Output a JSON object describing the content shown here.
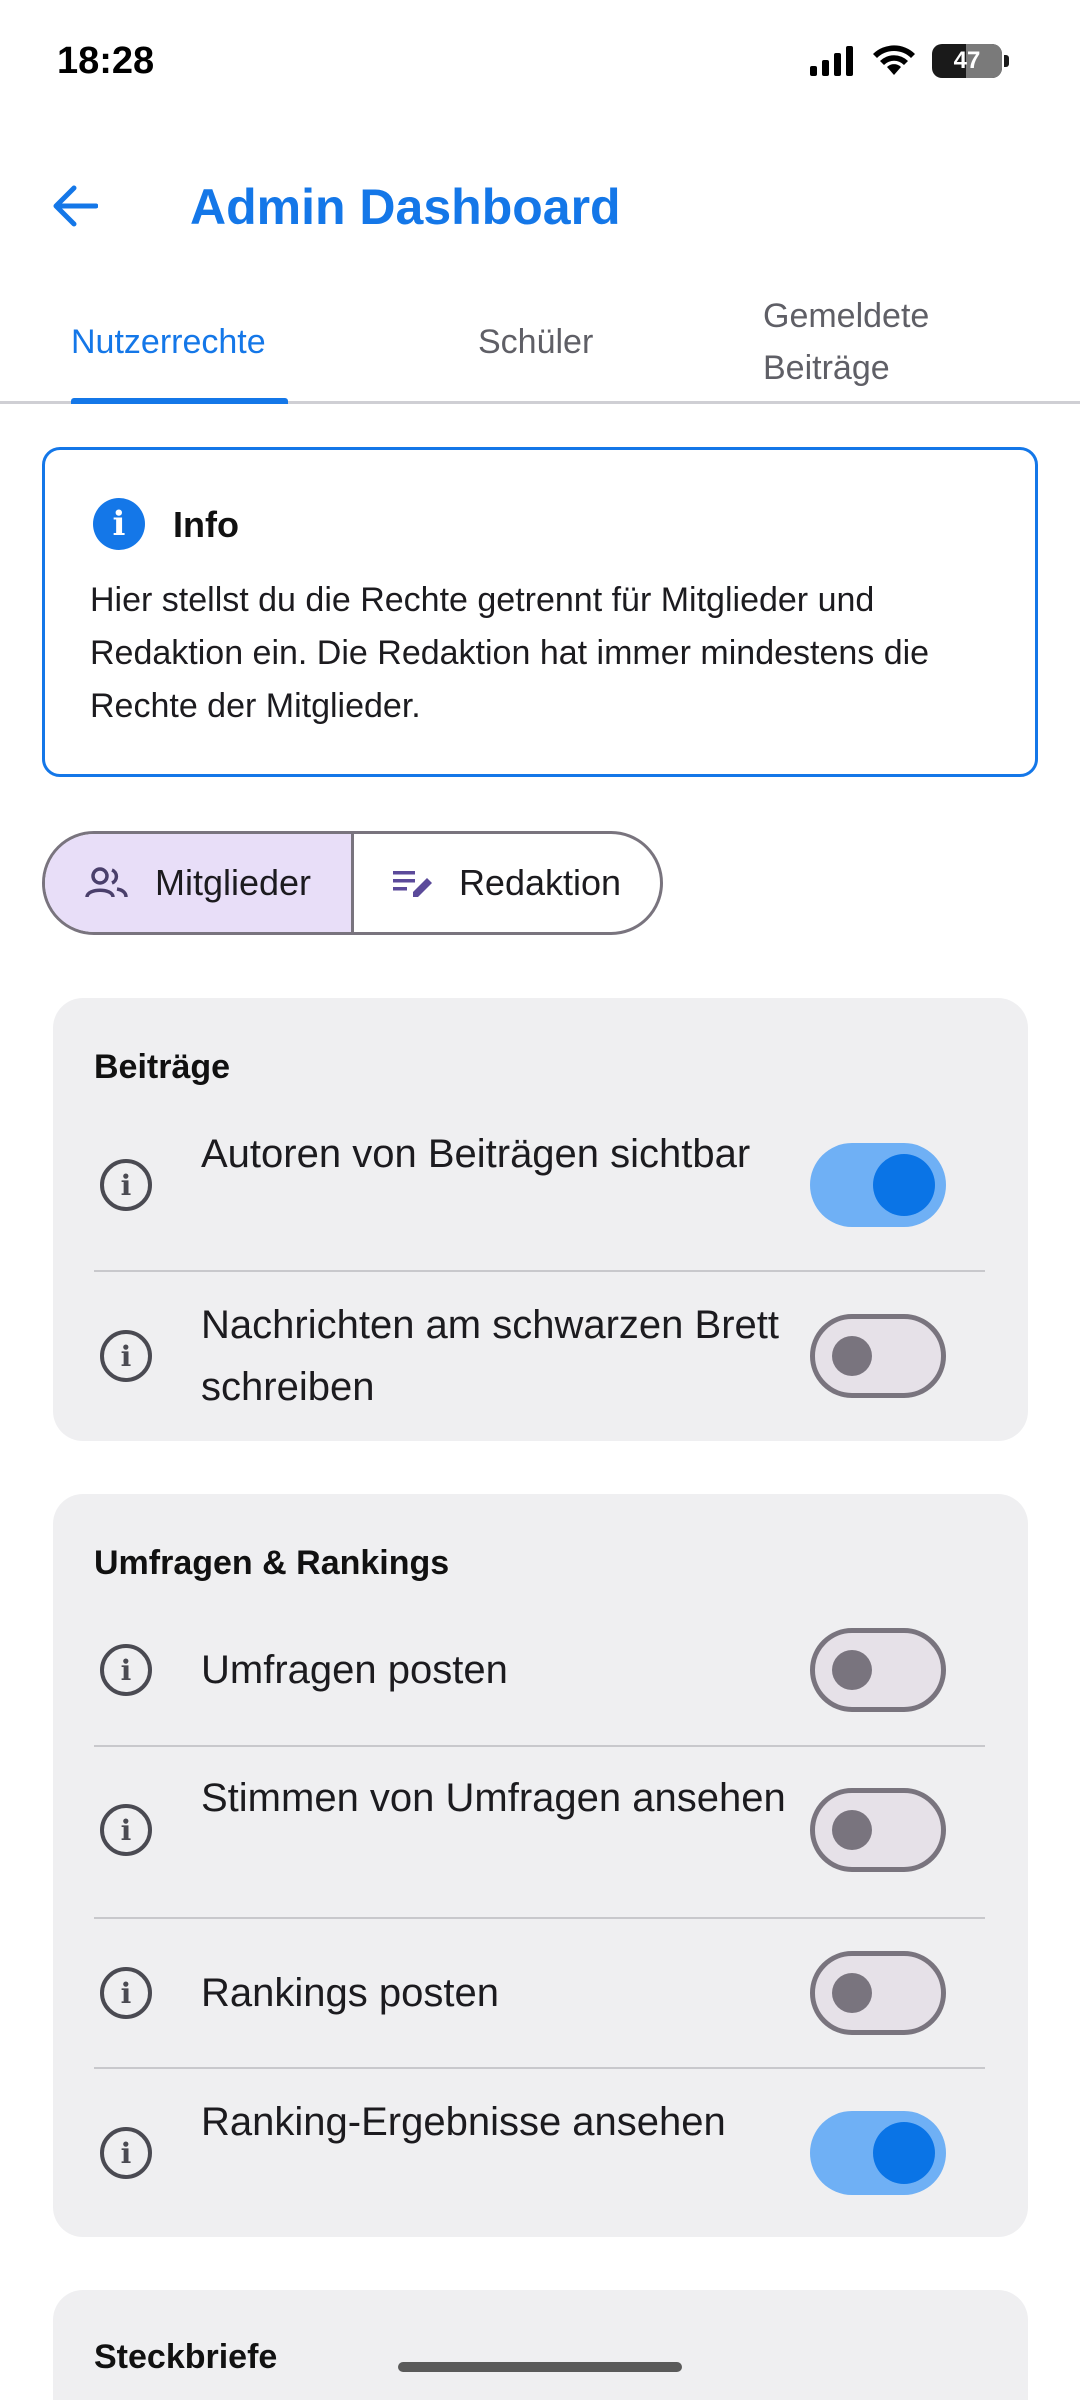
{
  "status": {
    "time": "18:28",
    "battery": "47"
  },
  "header": {
    "title": "Admin Dashboard"
  },
  "tabs": [
    {
      "label": "Nutzerrechte",
      "active": true
    },
    {
      "label": "Schüler",
      "active": false
    },
    {
      "label": "Gemeldete Beiträge",
      "active": false
    }
  ],
  "info": {
    "title": "Info",
    "text": "Hier stellst du die Rechte getrennt für Mitglieder und Redaktion ein. Die Redaktion hat immer mindestens die Rechte der Mitglieder."
  },
  "segments": [
    {
      "label": "Mitglieder",
      "icon": "group-icon",
      "selected": true
    },
    {
      "label": "Redaktion",
      "icon": "edit-note-icon",
      "selected": false
    }
  ],
  "sections": [
    {
      "title": "Beiträge",
      "items": [
        {
          "label": "Autoren von Beiträgen sichtbar",
          "enabled": true
        },
        {
          "label": "Nachrichten am schwarzen Brett schreiben",
          "enabled": false
        }
      ]
    },
    {
      "title": "Umfragen & Rankings",
      "items": [
        {
          "label": "Umfragen posten",
          "enabled": false
        },
        {
          "label": "Stimmen von Umfragen ansehen",
          "enabled": false
        },
        {
          "label": "Rankings posten",
          "enabled": false
        },
        {
          "label": "Ranking-Ergebnisse ansehen",
          "enabled": true
        }
      ]
    },
    {
      "title": "Steckbriefe",
      "items": []
    }
  ],
  "colors": {
    "accent": "#1477e8",
    "switch_on_track": "#6fb0f5",
    "switch_on_knob": "#0a74e6",
    "segment_selected": "#e8def8"
  }
}
